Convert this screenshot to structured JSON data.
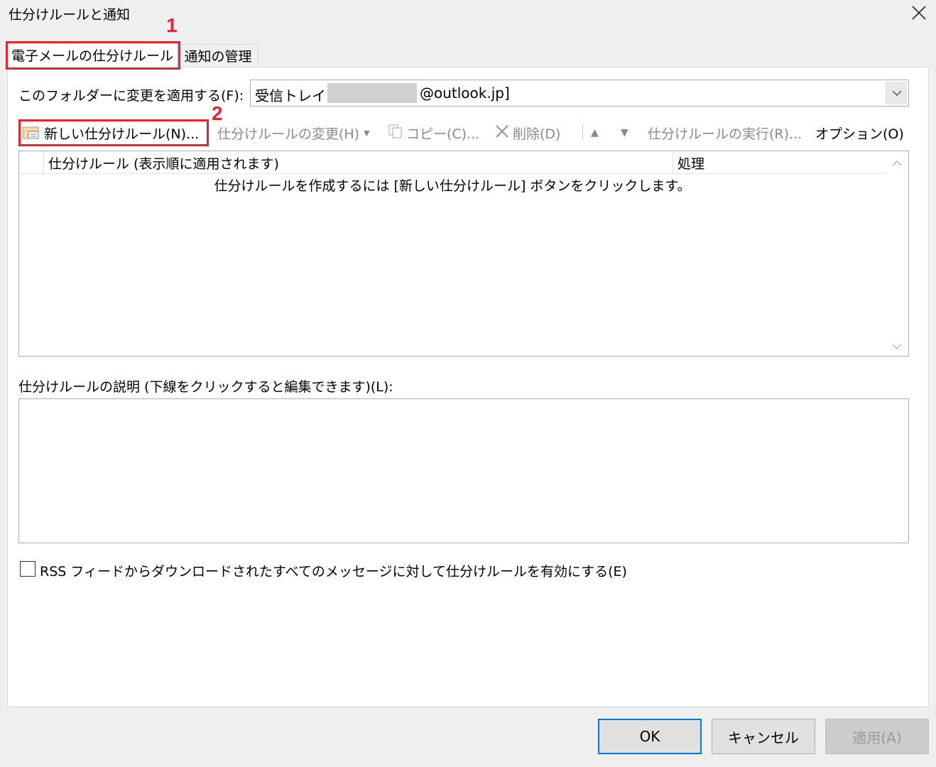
{
  "window": {
    "title": "仕分けルールと通知"
  },
  "tabs": [
    {
      "label": "電子メールの仕分けルール",
      "active": true
    },
    {
      "label": "通知の管理",
      "active": false
    }
  ],
  "annotations": {
    "step1": "1",
    "step2": "2",
    "color": "#e0262e"
  },
  "folder": {
    "label": "このフォルダーに変更を適用する(F):",
    "value_prefix": "受信トレイ [",
    "value_suffix": "@outlook.jp]"
  },
  "toolbar": {
    "new_rule": "新しい仕分けルール(N)...",
    "change_rule": "仕分けルールの変更(H)",
    "copy": "コピー(C)...",
    "delete": "削除(D)",
    "run_rules": "仕分けルールの実行(R)...",
    "options": "オプション(O)"
  },
  "rules_list": {
    "col_rule": "仕分けルール (表示順に適用されます)",
    "col_action": "処理",
    "empty_message": "仕分けルールを作成するには [新しい仕分けルール] ボタンをクリックします。"
  },
  "description": {
    "label": "仕分けルールの説明 (下線をクリックすると編集できます)(L):"
  },
  "rss_checkbox": {
    "label": "RSS フィードからダウンロードされたすべてのメッセージに対して仕分けルールを有効にする(E)",
    "checked": false
  },
  "buttons": {
    "ok": "OK",
    "cancel": "キャンセル",
    "apply": "適用(A)"
  },
  "colors": {
    "accent": "#0078d7",
    "highlight": "#e0262e",
    "disabled_text": "#8a8a8a"
  }
}
